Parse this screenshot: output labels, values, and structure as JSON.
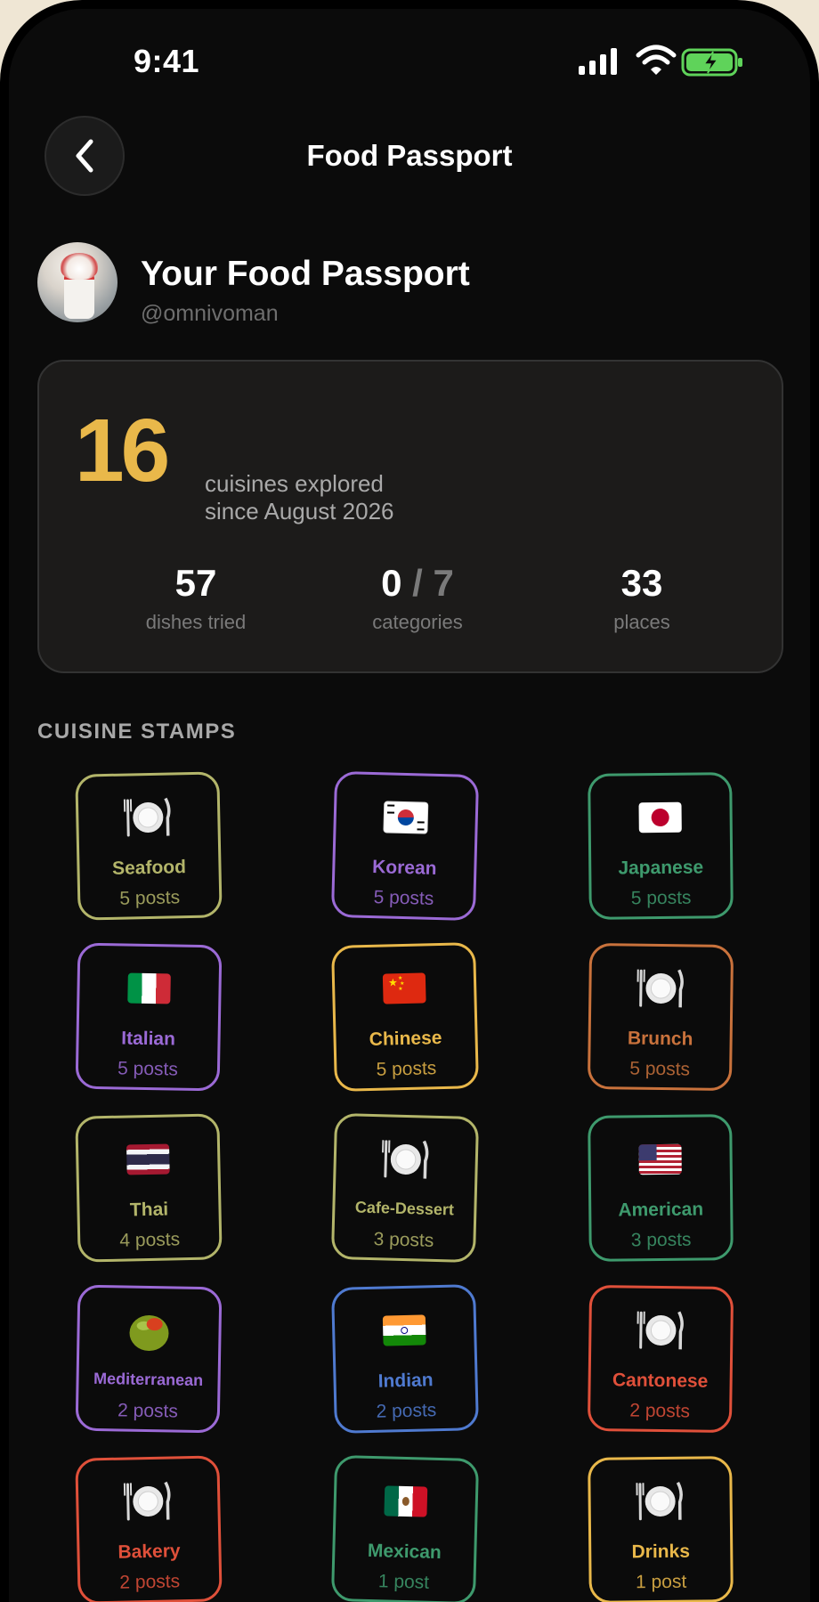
{
  "status_bar": {
    "time": "9:41"
  },
  "nav": {
    "title": "Food Passport"
  },
  "profile": {
    "title": "Your Food Passport",
    "handle": "@omnivoman"
  },
  "stats": {
    "cuisines_count": "16",
    "cuisines_caption_line1": "cuisines explored",
    "cuisines_caption_line2": "since August 2026",
    "dishes_value": "57",
    "dishes_label": "dishes tried",
    "categories_value": "0",
    "categories_separator": " / ",
    "categories_total": "7",
    "categories_label": "categories",
    "places_value": "33",
    "places_label": "places"
  },
  "section": {
    "title": "CUISINE STAMPS"
  },
  "stamps": [
    {
      "name": "Seafood",
      "count": "5 posts",
      "icon": "plate-icon",
      "color": "#b3b56a"
    },
    {
      "name": "Korean",
      "count": "5 posts",
      "icon": "flag-korea-icon",
      "color": "#9b6ad6"
    },
    {
      "name": "Japanese",
      "count": "5 posts",
      "icon": "flag-japan-icon",
      "color": "#3e9a6d"
    },
    {
      "name": "Italian",
      "count": "5 posts",
      "icon": "flag-italy-icon",
      "color": "#9b6ad6"
    },
    {
      "name": "Chinese",
      "count": "5 posts",
      "icon": "flag-china-icon",
      "color": "#e9b84a"
    },
    {
      "name": "Brunch",
      "count": "5 posts",
      "icon": "plate-icon",
      "color": "#c9723c"
    },
    {
      "name": "Thai",
      "count": "4 posts",
      "icon": "flag-thailand-icon",
      "color": "#b3b56a"
    },
    {
      "name": "Cafe-Dessert",
      "count": "3 posts",
      "icon": "plate-icon",
      "color": "#b3b56a"
    },
    {
      "name": "American",
      "count": "3 posts",
      "icon": "flag-usa-icon",
      "color": "#3e9a6d"
    },
    {
      "name": "Mediterranean",
      "count": "2 posts",
      "icon": "olive-icon",
      "color": "#9b6ad6"
    },
    {
      "name": "Indian",
      "count": "2 posts",
      "icon": "flag-india-icon",
      "color": "#4f7ad0"
    },
    {
      "name": "Cantonese",
      "count": "2 posts",
      "icon": "plate-icon",
      "color": "#e0503a"
    },
    {
      "name": "Bakery",
      "count": "2 posts",
      "icon": "plate-icon",
      "color": "#e0503a"
    },
    {
      "name": "Mexican",
      "count": "1 post",
      "icon": "flag-mexico-icon",
      "color": "#3e9a6d"
    },
    {
      "name": "Drinks",
      "count": "1 post",
      "icon": "plate-icon",
      "color": "#e9b84a"
    }
  ]
}
